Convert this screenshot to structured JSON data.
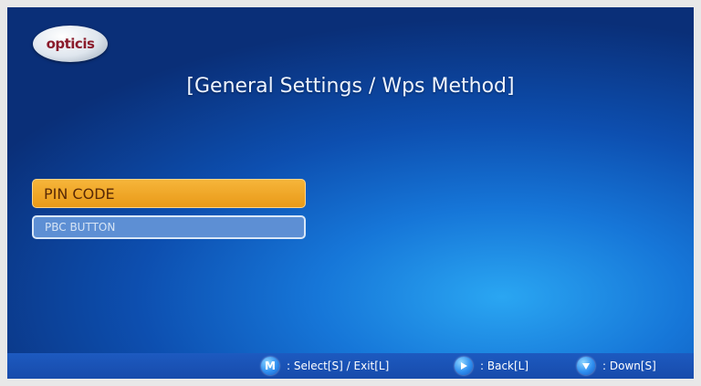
{
  "logo": {
    "text": "opticis"
  },
  "title": "[General Settings / Wps Method]",
  "menu": {
    "items": [
      {
        "label": "PIN CODE",
        "selected": true
      },
      {
        "label": "PBC BUTTON",
        "selected": false
      }
    ]
  },
  "footer": {
    "hints": [
      {
        "key": "M",
        "icon": "m-button-icon",
        "text": ": Select[S] / Exit[L]"
      },
      {
        "key": "",
        "icon": "right-arrow-icon",
        "text": ": Back[L]"
      },
      {
        "key": "",
        "icon": "down-arrow-icon",
        "text": ": Down[S]"
      }
    ]
  },
  "colors": {
    "selected_item": "#f0a62a",
    "normal_item": "#5d8fd4",
    "background": "#1676d8"
  }
}
